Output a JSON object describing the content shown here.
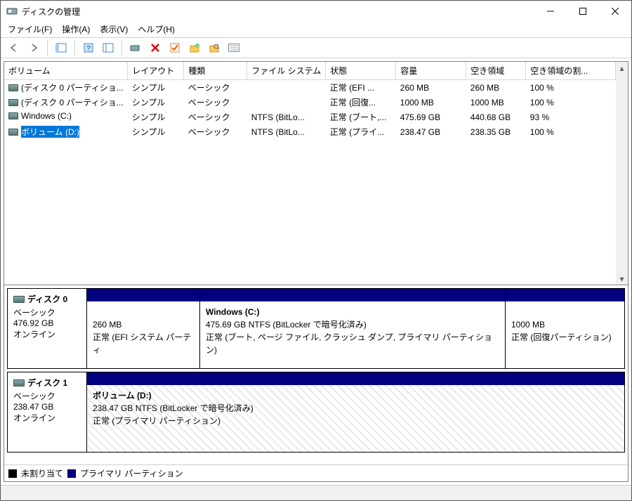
{
  "window": {
    "title": "ディスクの管理"
  },
  "menu": {
    "file": "ファイル(F)",
    "action": "操作(A)",
    "view": "表示(V)",
    "help": "ヘルプ(H)"
  },
  "columns": {
    "volume": "ボリューム",
    "layout": "レイアウト",
    "type": "種類",
    "filesystem": "ファイル システム",
    "status": "状態",
    "capacity": "容量",
    "free": "空き領域",
    "freepct": "空き領域の割..."
  },
  "rows": [
    {
      "vol": "(ディスク 0 パーティショ...",
      "layout": "シンプル",
      "type": "ベーシック",
      "fs": "",
      "status": "正常 (EFI ...",
      "cap": "260 MB",
      "free": "260 MB",
      "pct": "100 %",
      "sel": false
    },
    {
      "vol": "(ディスク 0 パーティショ...",
      "layout": "シンプル",
      "type": "ベーシック",
      "fs": "",
      "status": "正常 (回復...",
      "cap": "1000 MB",
      "free": "1000 MB",
      "pct": "100 %",
      "sel": false
    },
    {
      "vol": "Windows (C:)",
      "layout": "シンプル",
      "type": "ベーシック",
      "fs": "NTFS (BitLo...",
      "status": "正常 (ブート,...",
      "cap": "475.69 GB",
      "free": "440.68 GB",
      "pct": "93 %",
      "sel": false
    },
    {
      "vol": "ボリューム (D:)",
      "layout": "シンプル",
      "type": "ベーシック",
      "fs": "NTFS (BitLo...",
      "status": "正常 (プライ...",
      "cap": "238.47 GB",
      "free": "238.35 GB",
      "pct": "100 %",
      "sel": true
    }
  ],
  "disk0": {
    "name": "ディスク 0",
    "type": "ベーシック",
    "size": "476.92 GB",
    "status": "オンライン",
    "p1": {
      "size": "260 MB",
      "status": "正常 (EFI システム パーティ"
    },
    "p2": {
      "name": "Windows  (C:)",
      "detail": "475.69 GB NTFS (BitLocker で暗号化済み)",
      "status": "正常 (ブート, ページ ファイル, クラッシュ ダンプ, プライマリ パーティション)"
    },
    "p3": {
      "size": "1000 MB",
      "status": "正常 (回復パーティション)"
    }
  },
  "disk1": {
    "name": "ディスク 1",
    "type": "ベーシック",
    "size": "238.47 GB",
    "status": "オンライン",
    "p1": {
      "name": "ボリューム  (D:)",
      "detail": "238.47 GB NTFS (BitLocker で暗号化済み)",
      "status": "正常 (プライマリ パーティション)"
    }
  },
  "legend": {
    "unalloc": "未割り当て",
    "primary": "プライマリ パーティション"
  }
}
